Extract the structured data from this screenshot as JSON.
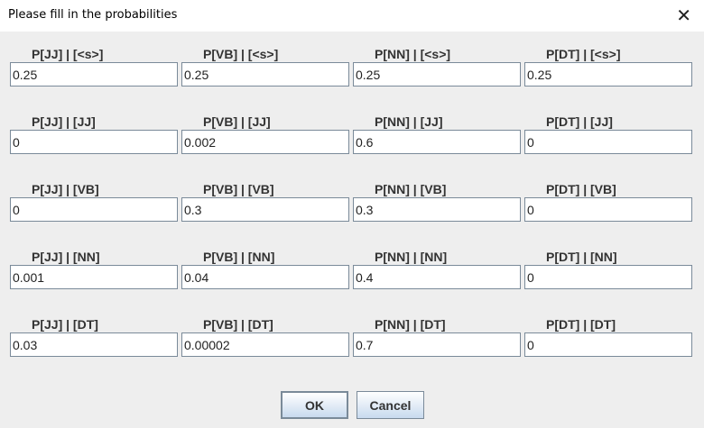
{
  "window": {
    "title": "Please fill in the probabilities",
    "close_icon": "close-icon"
  },
  "rows": [
    {
      "labels": [
        "P[JJ] | [<s>]",
        "P[VB] | [<s>]",
        "P[NN] | [<s>]",
        "P[DT] | [<s>]"
      ],
      "values": [
        "0.25",
        "0.25",
        "0.25",
        "0.25"
      ]
    },
    {
      "labels": [
        "P[JJ] | [JJ]",
        "P[VB] | [JJ]",
        "P[NN] | [JJ]",
        "P[DT] | [JJ]"
      ],
      "values": [
        "0",
        "0.002",
        "0.6",
        "0"
      ]
    },
    {
      "labels": [
        "P[JJ] | [VB]",
        "P[VB] | [VB]",
        "P[NN] | [VB]",
        "P[DT] | [VB]"
      ],
      "values": [
        "0",
        "0.3",
        "0.3",
        "0"
      ]
    },
    {
      "labels": [
        "P[JJ] | [NN]",
        "P[VB] | [NN]",
        "P[NN] | [NN]",
        "P[DT] | [NN]"
      ],
      "values": [
        "0.001",
        "0.04",
        "0.4",
        "0"
      ]
    },
    {
      "labels": [
        "P[JJ] | [DT]",
        "P[VB] | [DT]",
        "P[NN] | [DT]",
        "P[DT] | [DT]"
      ],
      "values": [
        "0.03",
        "0.00002",
        "0.7",
        "0"
      ]
    }
  ],
  "buttons": {
    "ok": "OK",
    "cancel": "Cancel"
  }
}
